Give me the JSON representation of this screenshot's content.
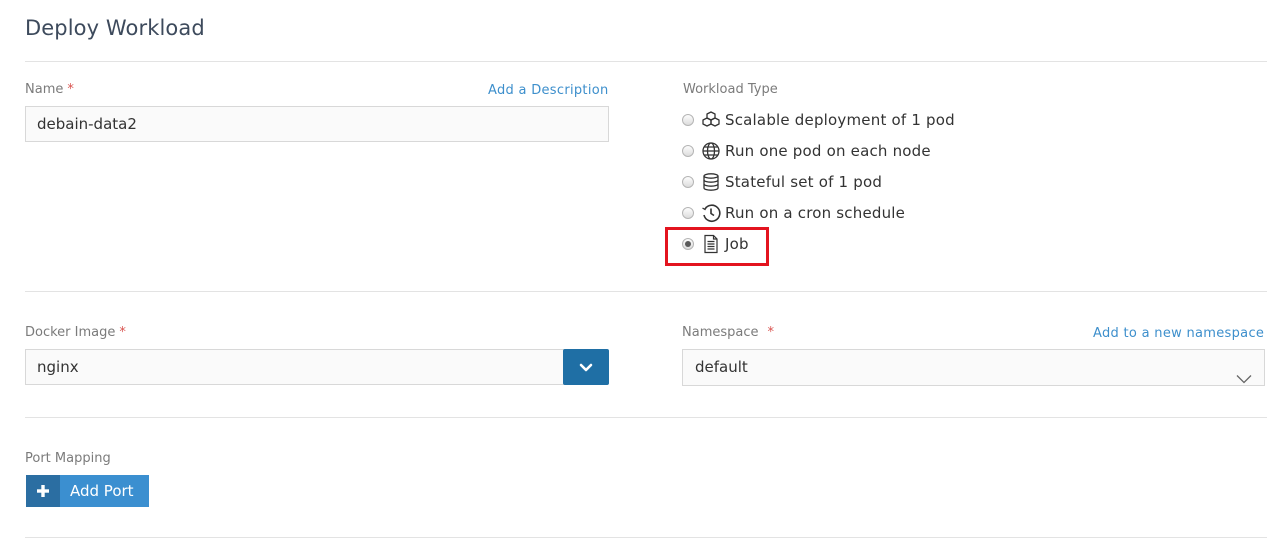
{
  "page": {
    "title": "Deploy Workload"
  },
  "name_field": {
    "label": "Name",
    "required_mark": "*",
    "value": "debain-data2",
    "add_description_link": "Add a Description"
  },
  "workload_type": {
    "label": "Workload Type",
    "options": [
      {
        "label": "Scalable deployment of 1 pod",
        "icon": "cubes-icon",
        "selected": false
      },
      {
        "label": "Run one pod on each node",
        "icon": "globe-icon",
        "selected": false
      },
      {
        "label": "Stateful set of 1 pod",
        "icon": "database-icon",
        "selected": false
      },
      {
        "label": "Run on a cron schedule",
        "icon": "clock-icon",
        "selected": false
      },
      {
        "label": "Job",
        "icon": "document-icon",
        "selected": true
      }
    ],
    "highlight_color": "#e3141f"
  },
  "docker_image": {
    "label": "Docker Image",
    "required_mark": "*",
    "value": "nginx"
  },
  "namespace": {
    "label": "Namespace",
    "required_mark": "*",
    "value": "default",
    "add_namespace_link": "Add to a new namespace"
  },
  "port_mapping": {
    "label": "Port Mapping",
    "add_port_button": "Add Port"
  },
  "colors": {
    "accent": "#3b8fd0",
    "accent_dark": "#2b6ea2",
    "link": "#3d8fcc",
    "required": "#d9534f"
  }
}
